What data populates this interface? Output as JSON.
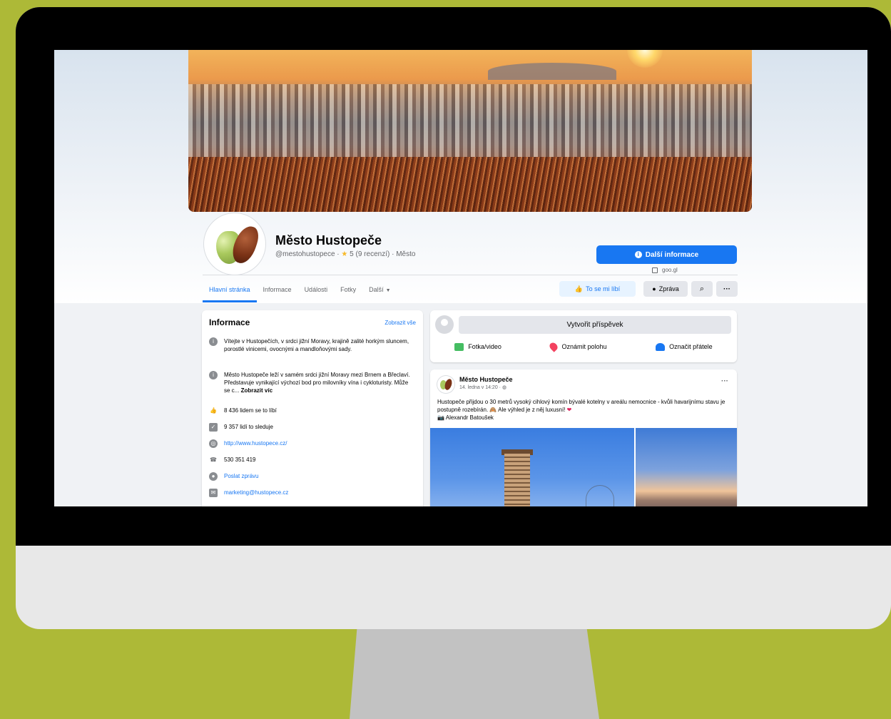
{
  "page": {
    "name": "Město Hustopeče",
    "handle": "@mestohustopece",
    "rating": "5 (9 recenzí)",
    "category": "Město",
    "more_info_label": "Další informace",
    "external_link": "goo.gl"
  },
  "nav": {
    "tabs": [
      "Hlavní stránka",
      "Informace",
      "Události",
      "Fotky",
      "Další"
    ]
  },
  "actions": {
    "like_label": "To se mi líbí",
    "message_label": "Zpráva",
    "search_icon": "⌕",
    "more_icon": "···"
  },
  "info": {
    "title": "Informace",
    "see_all": "Zobrazit vše",
    "about_1": "Vítejte v Hustopečích, v srdci jižní Moravy, krajině zalité horkým sluncem, porostlé vinicemi, ovocnými a mandloňovými sady.",
    "about_2": "Město Hustopeče leží v samém srdci jižní Moravy mezi Brnem a Břeclaví. Představuje vynikající výchozí bod pro milovníky vína i cykloturisty. Může se c...",
    "about_2_more": "Zobrazit víc",
    "likes": "8 436 lidem se to líbí",
    "followers": "9 357 lidí to sleduje",
    "website": "http://www.hustopece.cz/",
    "phone": "530 351 419",
    "send_message": "Poslat zprávu",
    "email": "marketing@hustopece.cz"
  },
  "composer": {
    "placeholder": "Vytvořit příspěvek",
    "photo_label": "Fotka/video",
    "location_label": "Oznámit polohu",
    "tag_label": "Označit přátele"
  },
  "post": {
    "author": "Město Hustopeče",
    "time": "14. ledna v 14:20 · ",
    "text": "Hustopeče přijdou o 30 metrů vysoký cihlový komín bývalé kotelny v areálu nemocnice - kvůli havarijnímu stavu je postupně rozebírán. 🙈 Ale výhled je z něj luxusní! ",
    "photo_credit": "📷 Alexandr Batoušek"
  },
  "colors": {
    "background": "#adb937",
    "accent": "#1877f2"
  }
}
